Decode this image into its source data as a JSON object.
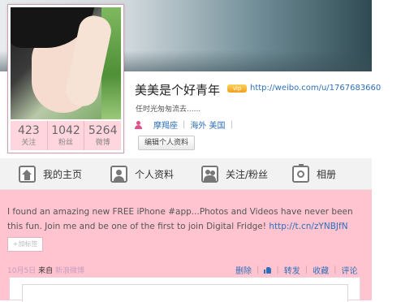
{
  "profile": {
    "name": "美美是个好青年",
    "vip_badge": "vip",
    "url": "http://weibo.com/u/1767683660",
    "bio": "任时光匆匆流去......",
    "constellation": "摩羯座",
    "location": "海外 美国",
    "edit_button": "编辑个人资料"
  },
  "stats": [
    {
      "count": "423",
      "label": "关注"
    },
    {
      "count": "1042",
      "label": "粉丝"
    },
    {
      "count": "5264",
      "label": "微博"
    }
  ],
  "nav": {
    "home": "我的主页",
    "info": "个人资料",
    "follow": "关注/粉丝",
    "album": "相册"
  },
  "post": {
    "text": "I found an amazing new FREE iPhone #app...Photos and Videos have never been this fun. Join me and be one of the first to join Digital Fridge!",
    "link": "http://t.cn/zYNBJfN",
    "tag": "+加标签",
    "time": "10月5日",
    "from_label": "来自",
    "source": "新浪微博",
    "actions": {
      "delete": "删除",
      "repost": "转发",
      "favorite": "收藏",
      "comment": "评论"
    }
  },
  "colors": {
    "accent_pink": "#ffc4cf",
    "link_blue": "#2f6fb8"
  }
}
